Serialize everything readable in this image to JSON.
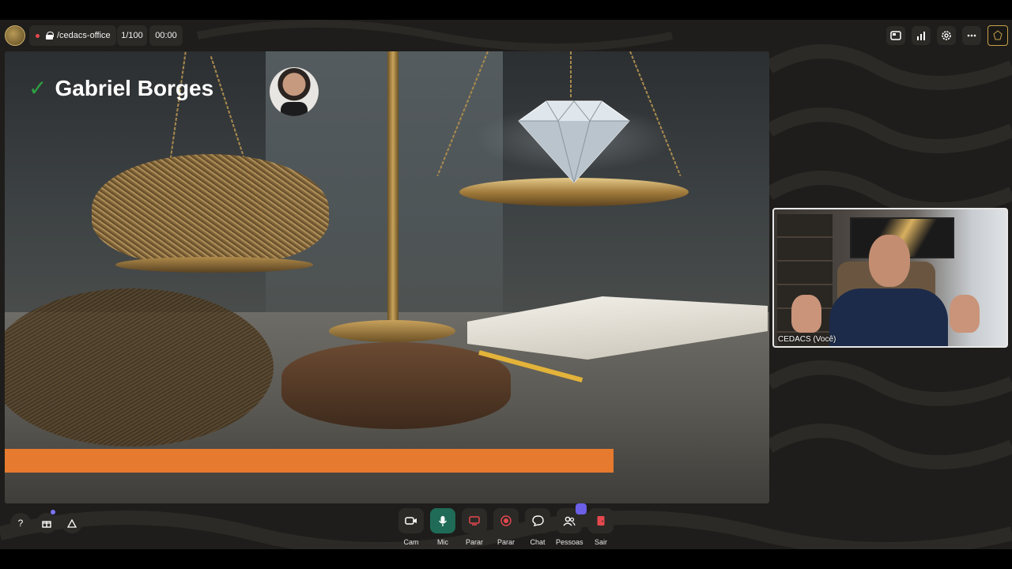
{
  "topbar": {
    "room_name": "/cedacs-office",
    "participant_count": "1/100",
    "timer": "00:00",
    "icons": [
      "logo-icon",
      "screen-icon",
      "stats-icon",
      "settings-gear-icon",
      "more-icon",
      "brand-icon"
    ]
  },
  "slide": {
    "presenter_name": "Gabriel Borges",
    "check_mark": "✓",
    "progress_fraction": 0.796,
    "accent_color": "#e67a2e",
    "check_color": "#2ea043"
  },
  "self_view": {
    "label": "CEDACS (Você)"
  },
  "bottom_left": {
    "help_label": "?"
  },
  "controls": [
    {
      "key": "cam",
      "label": "Cam",
      "icon": "camera-icon"
    },
    {
      "key": "mic",
      "label": "Mic",
      "icon": "microphone-icon"
    },
    {
      "key": "share",
      "label": "Parar",
      "icon": "screen-share-icon"
    },
    {
      "key": "record",
      "label": "Parar",
      "icon": "record-icon"
    },
    {
      "key": "chat",
      "label": "Chat",
      "icon": "chat-icon"
    },
    {
      "key": "people",
      "label": "Pessoas",
      "icon": "people-icon"
    },
    {
      "key": "leave",
      "label": "Sair",
      "icon": "leave-icon"
    }
  ],
  "colors": {
    "background": "#1e1d1b",
    "button_bg": "#2b2a27",
    "mic_active": "#1f6b57",
    "record_red": "#e5484d",
    "badge": "#6b5fe8"
  }
}
